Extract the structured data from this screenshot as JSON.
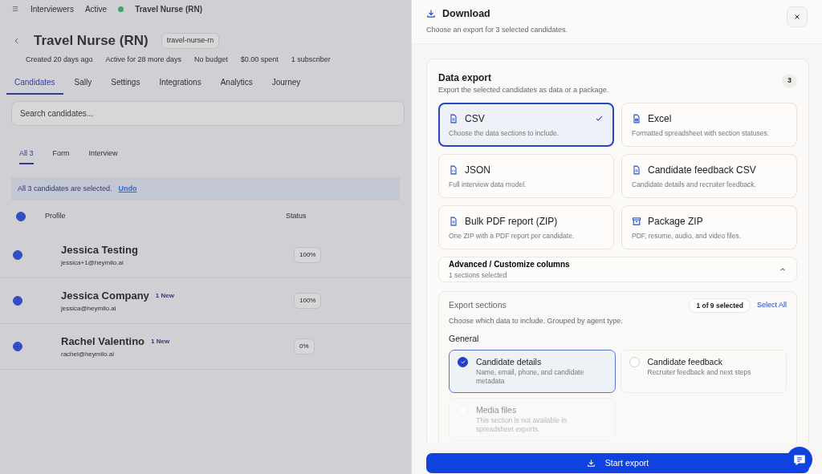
{
  "background": {
    "breadcrumb": [
      "Interviewers",
      "Active",
      "Travel Nurse (RN)"
    ],
    "title": "Travel Nurse (RN)",
    "slug": "travel-nurse-rn",
    "meta": [
      "Created 20 days ago",
      "Active for 28 more days",
      "No budget",
      "$0.00 spent",
      "1 subscriber"
    ],
    "tabs": [
      {
        "label": "Candidates",
        "selected": true
      },
      {
        "label": "Sally",
        "selected": false
      },
      {
        "label": "Settings",
        "selected": false
      },
      {
        "label": "Integrations",
        "selected": false
      },
      {
        "label": "Analytics",
        "selected": false
      },
      {
        "label": "Journey",
        "selected": false
      }
    ],
    "search": {
      "placeholder": "Search candidates..."
    },
    "filters": [
      {
        "label": "All 3",
        "selected": true
      },
      {
        "label": "Form",
        "selected": false
      },
      {
        "label": "Interview",
        "selected": false
      }
    ],
    "banner": {
      "text": "All 3 candidates are selected.",
      "action": "Undo"
    },
    "table": {
      "columns": [
        "Profile",
        "Status"
      ],
      "all_checked": true,
      "rows": [
        {
          "checked": true,
          "name": "Jessica Testing",
          "badge": "",
          "email": "jessica+1@heymilo.ai",
          "status": "100%"
        },
        {
          "checked": true,
          "name": "Jessica Company",
          "badge": "1 New",
          "email": "jessica@heymilo.ai",
          "status": "100%"
        },
        {
          "checked": true,
          "name": "Rachel Valentino",
          "badge": "1 New",
          "email": "rachel@heymilo.ai",
          "status": "0%"
        }
      ]
    }
  },
  "drawer": {
    "title": "Download",
    "subtitle": "Choose an export for 3 selected candidates.",
    "card": {
      "title": "Data export",
      "subtitle": "Export the selected candidates as data or a package.",
      "count": "3",
      "options": [
        {
          "kind": "file",
          "label": "CSV",
          "description": "Choose the data sections to include.",
          "selected": true
        },
        {
          "kind": "sheet",
          "label": "Excel",
          "description": "Formatted spreadsheet with section statuses.",
          "selected": false
        },
        {
          "kind": "code",
          "label": "JSON",
          "description": "Full interview data model.",
          "selected": false
        },
        {
          "kind": "file",
          "label": "Candidate feedback CSV",
          "description": "Candidate details and recruiter feedback.",
          "selected": false
        },
        {
          "kind": "file",
          "label": "Bulk PDF report (ZIP)",
          "description": "One ZIP with a PDF report per candidate.",
          "selected": false
        },
        {
          "kind": "archive",
          "label": "Package ZIP",
          "description": "PDF, resume, audio, and video files.",
          "selected": false
        }
      ],
      "advanced": {
        "title": "Advanced / Customize columns",
        "subtitle": "1 sections selected",
        "expanded": true
      },
      "sections": {
        "title": "Export sections",
        "subtitle": "Choose which data to include. Grouped by agent type.",
        "count": "1 of 9 selected",
        "select_all": "Select All",
        "groups": [
          {
            "name": "General",
            "items": [
              {
                "label": "Candidate details",
                "description": "Name, email, phone, and candidate metadata",
                "checked": true,
                "disabled": false
              },
              {
                "label": "Candidate feedback",
                "description": "Recruiter feedback and next steps",
                "checked": false,
                "disabled": false
              },
              {
                "label": "Media files",
                "description": "This section is not available in spreadsheet exports.",
                "checked": false,
                "disabled": true
              }
            ]
          }
        ]
      }
    },
    "button": "Start export"
  }
}
